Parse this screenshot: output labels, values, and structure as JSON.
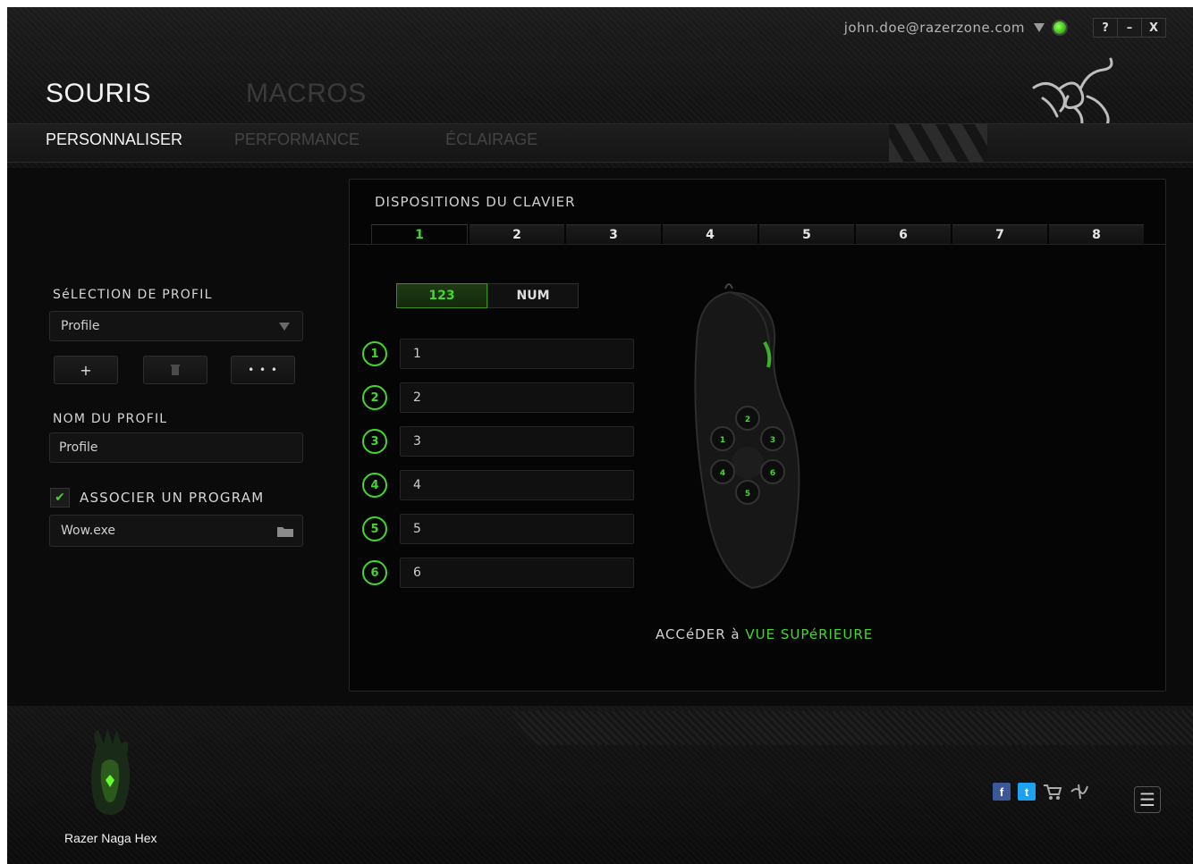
{
  "window": {
    "user_email": "john.doe@razerzone.com",
    "controls": [
      "?",
      "–",
      "X"
    ]
  },
  "main_tabs": [
    {
      "label": "SOURIS",
      "active": true
    },
    {
      "label": "MACROS",
      "active": false
    }
  ],
  "sub_tabs": [
    {
      "label": "PERSONNALISER",
      "active": true
    },
    {
      "label": "PERFORMANCE",
      "active": false
    },
    {
      "label": "ÉCLAIRAGE",
      "active": false
    }
  ],
  "profile": {
    "selection_label": "SéLECTION DE PROFIL",
    "selected": "Profile",
    "add_label": "+",
    "delete_label": "🗑",
    "more_label": "• • •",
    "name_label": "NOM DU PROFIL",
    "name_value": "Profile",
    "link_program_label": "ASSOCIER UN PROGRAM",
    "link_program_checked": true,
    "program_value": "Wow.exe"
  },
  "keymap": {
    "title": "DISPOSITIONS DU CLAVIER",
    "tabs": [
      "1",
      "2",
      "3",
      "4",
      "5",
      "6",
      "7",
      "8"
    ],
    "active_tab": "1",
    "toggle": [
      "123",
      "NUM"
    ],
    "toggle_active": "123",
    "buttons": [
      {
        "num": "1",
        "value": "1"
      },
      {
        "num": "2",
        "value": "2"
      },
      {
        "num": "3",
        "value": "3"
      },
      {
        "num": "4",
        "value": "4"
      },
      {
        "num": "5",
        "value": "5"
      },
      {
        "num": "6",
        "value": "6"
      }
    ],
    "access_prefix": "ACCéDER à ",
    "access_link": "VUE SUPéRIEURE"
  },
  "footer": {
    "device_name": "Razer Naga Hex",
    "icons": [
      "facebook-icon",
      "twitter-icon",
      "cart-icon",
      "razer-icon",
      "menu-icon"
    ]
  },
  "colors": {
    "accent": "#44d62c",
    "background": "#0b0b0b"
  }
}
